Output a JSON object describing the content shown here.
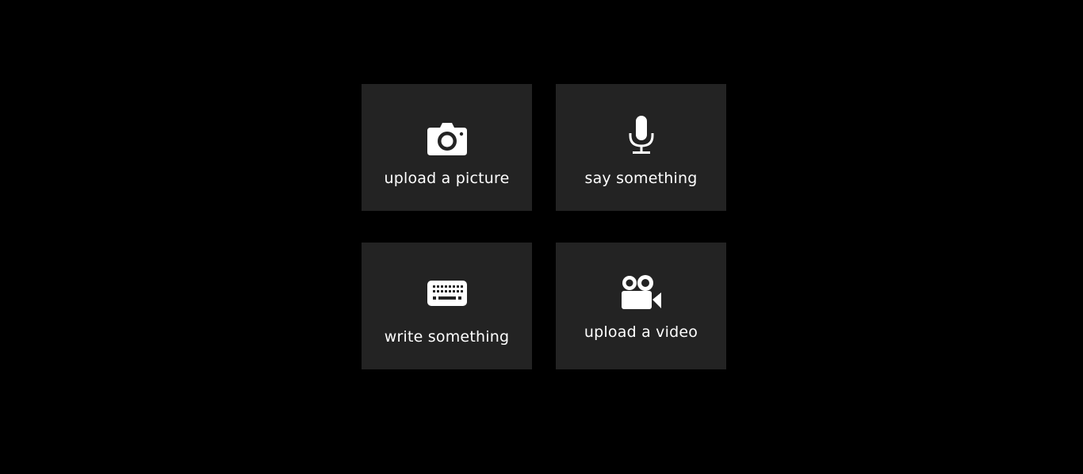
{
  "theme": {
    "background": "#000000",
    "tile_background": "#232323",
    "foreground": "#ffffff"
  },
  "options": [
    {
      "id": "picture",
      "label": "upload a picture",
      "icon": "camera-icon"
    },
    {
      "id": "say",
      "label": "say something",
      "icon": "microphone-icon"
    },
    {
      "id": "write",
      "label": "write something",
      "icon": "keyboard-icon"
    },
    {
      "id": "video",
      "label": "upload a video",
      "icon": "video-camera-icon"
    }
  ]
}
